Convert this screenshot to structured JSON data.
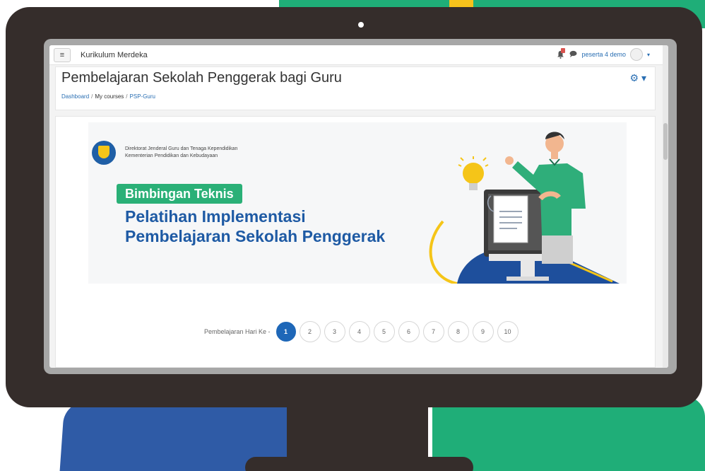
{
  "navbar": {
    "site_name": "Kurikulum Merdeka",
    "user_name": "peserta 4 demo",
    "menu_icon": "hamburger-icon",
    "notification_icon": "bell-icon",
    "message_icon": "chat-icon",
    "caret": "▾"
  },
  "header": {
    "title": "Pembelajaran Sekolah Penggerak bagi Guru",
    "breadcrumb": [
      "Dashboard",
      "My courses",
      "PSP-Guru"
    ],
    "settings_icon": "gear-icon",
    "settings_label": "⚙ ▾"
  },
  "banner": {
    "org_line1": "Direktorat Jenderal Guru dan Tenaga Kependidikan",
    "org_line2": "Kementerian Pendidikan dan Kebudayaan",
    "pill": "Bimbingan Teknis",
    "headline_line1": "Pelatihan Implementasi",
    "headline_line2": "Pembelajaran Sekolah Penggerak"
  },
  "pager": {
    "label": "Pembelajaran Hari Ke -",
    "pages": [
      "1",
      "2",
      "3",
      "4",
      "5",
      "6",
      "7",
      "8",
      "9",
      "10"
    ],
    "active": "1"
  },
  "colors": {
    "brand_blue": "#1e5aa4",
    "brand_green": "#2ab077",
    "link_blue": "#2a6fb3",
    "monitor": "#352d2b"
  }
}
